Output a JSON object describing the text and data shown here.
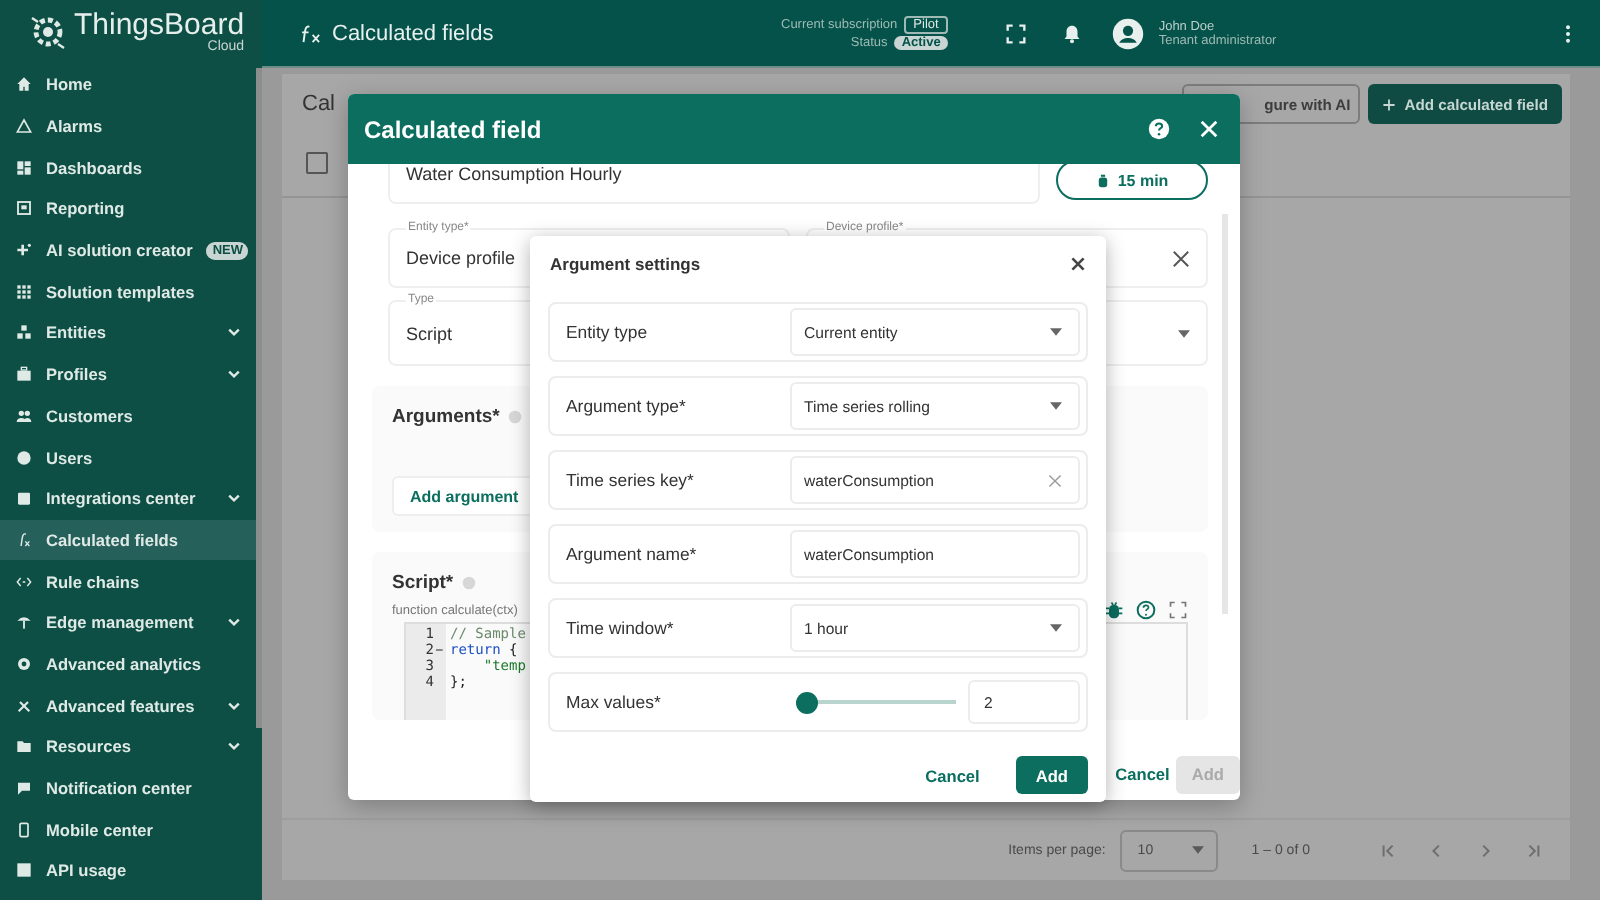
{
  "sidebar": {
    "logo": "ThingsBoard",
    "logo_sub": "Cloud",
    "items": [
      {
        "label": "Home",
        "selected": false,
        "expandable": false
      },
      {
        "label": "Alarms",
        "selected": false,
        "expandable": false
      },
      {
        "label": "Dashboards",
        "selected": false,
        "expandable": false
      },
      {
        "label": "Reporting",
        "selected": false,
        "expandable": false
      },
      {
        "label": "AI solution creator",
        "selected": false,
        "expandable": false,
        "badge": "NEW"
      },
      {
        "label": "Solution templates",
        "selected": false,
        "expandable": false
      },
      {
        "label": "Entities",
        "selected": false,
        "expandable": true
      },
      {
        "label": "Profiles",
        "selected": false,
        "expandable": true
      },
      {
        "label": "Customers",
        "selected": false,
        "expandable": false
      },
      {
        "label": "Users",
        "selected": false,
        "expandable": false
      },
      {
        "label": "Integrations center",
        "selected": false,
        "expandable": true
      },
      {
        "label": "Calculated fields",
        "selected": true,
        "expandable": false
      },
      {
        "label": "Rule chains",
        "selected": false,
        "expandable": false
      },
      {
        "label": "Edge management",
        "selected": false,
        "expandable": true
      },
      {
        "label": "Advanced analytics",
        "selected": false,
        "expandable": false
      },
      {
        "label": "Advanced features",
        "selected": false,
        "expandable": true
      },
      {
        "label": "Resources",
        "selected": false,
        "expandable": true
      },
      {
        "label": "Notification center",
        "selected": false,
        "expandable": false
      },
      {
        "label": "Mobile center",
        "selected": false,
        "expandable": false
      },
      {
        "label": "API usage",
        "selected": false,
        "expandable": false
      }
    ]
  },
  "topbar": {
    "title": "Calculated fields",
    "subscription_label": "Current subscription",
    "subscription": "Pilot",
    "status_label": "Status",
    "status": "Active",
    "user_name": "John Doe",
    "user_role": "Tenant administrator"
  },
  "page": {
    "title": "Cal",
    "configure_button": "gure with AI",
    "add_button": "Add calculated field",
    "select_all_checked": false,
    "items_per_page_label": "Items per page:",
    "items_per_page": "10",
    "range": "1 – 0 of 0"
  },
  "dialog": {
    "title": "Calculated field",
    "name": "Water Consumption Hourly",
    "interval": "15 min",
    "entity_type_label": "Entity type*",
    "entity_type": "Device profile",
    "device_profile_label": "Device profile*",
    "type_label": "Type",
    "type": "Script",
    "arguments_title": "Arguments*",
    "add_argument": "Add argument",
    "script_title": "Script*",
    "script_signature": "function calculate(ctx)",
    "code": [
      {
        "num": "1",
        "foldable": false,
        "tokens": [
          {
            "text": "// Sample",
            "kind": "comment"
          }
        ]
      },
      {
        "num": "2",
        "foldable": true,
        "tokens": [
          {
            "text": "return",
            "kind": "keyword"
          },
          {
            "text": " {",
            "kind": "plain"
          }
        ]
      },
      {
        "num": "3",
        "foldable": false,
        "tokens": [
          {
            "text": "    \"temp",
            "kind": "string"
          }
        ]
      },
      {
        "num": "4",
        "foldable": false,
        "tokens": [
          {
            "text": "};",
            "kind": "plain"
          }
        ]
      }
    ],
    "cancel": "Cancel",
    "submit": "Add",
    "submit_disabled": true
  },
  "argument_settings": {
    "title": "Argument settings",
    "rows": [
      {
        "kind": "select",
        "label": "Entity type",
        "value": "Current entity"
      },
      {
        "kind": "select",
        "label": "Argument type*",
        "value": "Time series rolling"
      },
      {
        "kind": "input",
        "label": "Time series key*",
        "value": "waterConsumption",
        "clearable": true
      },
      {
        "kind": "input",
        "label": "Argument name*",
        "value": "waterConsumption",
        "clearable": false
      },
      {
        "kind": "select",
        "label": "Time window*",
        "value": "1 hour"
      },
      {
        "kind": "slider",
        "label": "Max values*",
        "level": 0.04,
        "value": "2"
      }
    ],
    "cancel": "Cancel",
    "submit": "Add"
  }
}
